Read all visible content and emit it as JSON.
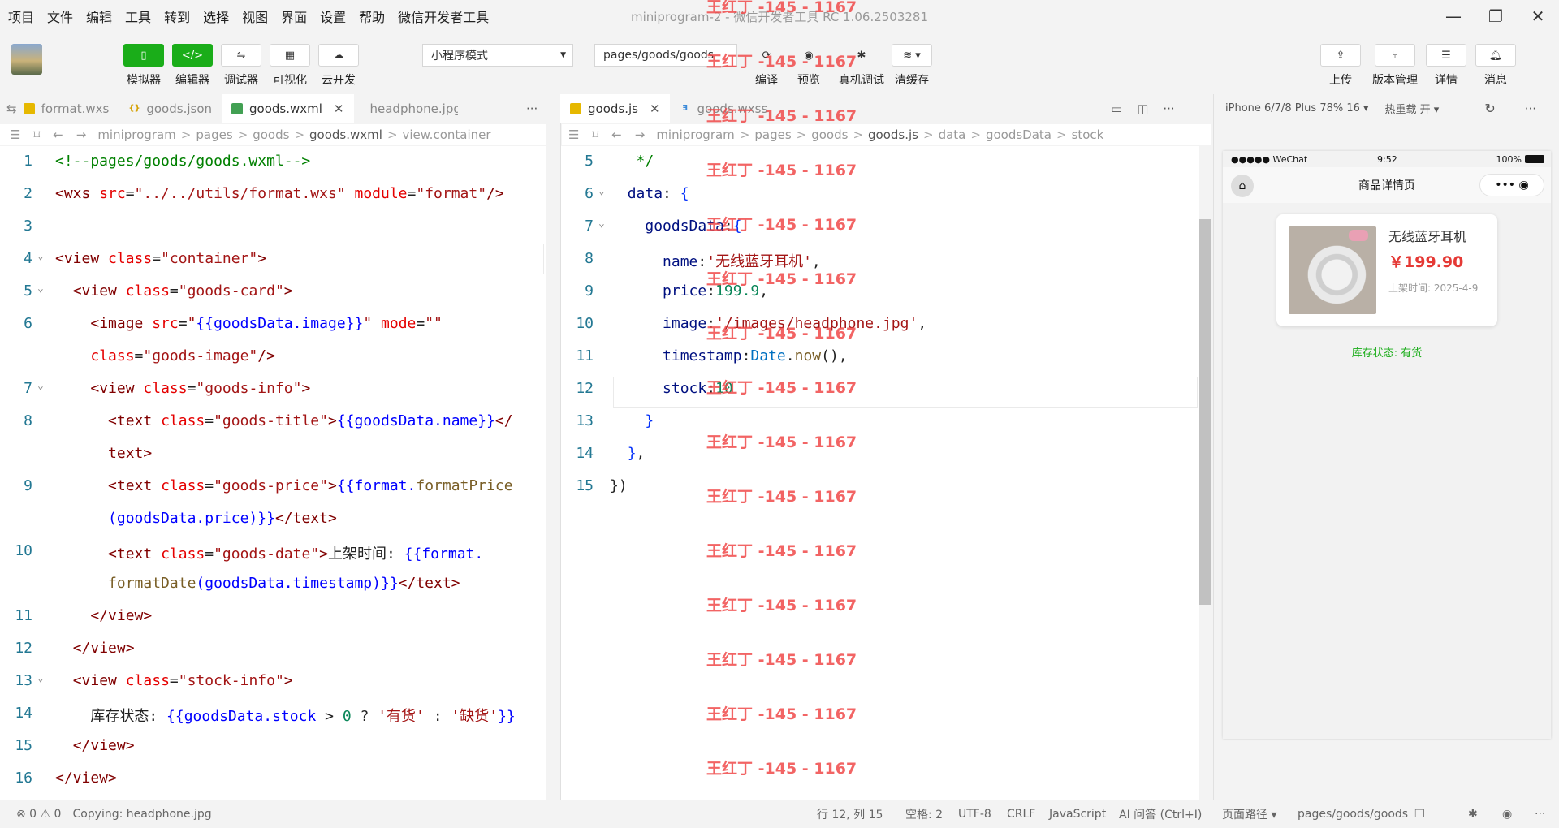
{
  "menu": [
    "项目",
    "文件",
    "编辑",
    "工具",
    "转到",
    "选择",
    "视图",
    "界面",
    "设置",
    "帮助",
    "微信开发者工具"
  ],
  "window_title": "miniprogram-2 - 微信开发者工具 RC 1.06.2503281",
  "window_controls": {
    "minimize": "—",
    "restore": "❐",
    "close": "✕"
  },
  "toolbar": {
    "simulator": "模拟器",
    "editor": "编辑器",
    "debugger": "调试器",
    "visual": "可视化",
    "cloud": "云开发",
    "mode_select": "小程序模式",
    "page_select": "pages/goods/goods",
    "compile": "编译",
    "preview": "预览",
    "remote_debug": "真机调试",
    "clear_cache": "清缓存",
    "upload": "上传",
    "version": "版本管理",
    "details": "详情",
    "messages": "消息"
  },
  "left_tabs": [
    "format.wxs",
    "goods.json",
    "goods.wxml",
    "headphone.jpg"
  ],
  "right_tabs": [
    "goods.js",
    "goods.wxss"
  ],
  "left_breadcrumb": [
    "miniprogram",
    "pages",
    "goods",
    "goods.wxml",
    "view.container"
  ],
  "right_breadcrumb": [
    "miniprogram",
    "pages",
    "goods",
    "goods.js",
    "data",
    "goodsData",
    "stock"
  ],
  "left_lines": [
    {
      "n": "1",
      "parts": [
        [
          "c-cm",
          "<!--pages/goods/goods.wxml-->"
        ]
      ]
    },
    {
      "n": "2",
      "parts": [
        [
          "c-tag",
          "<wxs "
        ],
        [
          "c-attr",
          "src"
        ],
        [
          "c-def",
          "="
        ],
        [
          "c-str",
          "\"../../utils/format.wxs\""
        ],
        [
          "c-def",
          " "
        ],
        [
          "c-attr",
          "module"
        ],
        [
          "c-def",
          "="
        ],
        [
          "c-str",
          "\"format\""
        ],
        [
          "c-tag",
          "/>"
        ]
      ]
    },
    {
      "n": "3",
      "parts": []
    },
    {
      "n": "4",
      "parts": [
        [
          "c-tag",
          "<view "
        ],
        [
          "c-attr",
          "class"
        ],
        [
          "c-def",
          "="
        ],
        [
          "c-str",
          "\"container\""
        ],
        [
          "c-tag",
          ">"
        ]
      ]
    },
    {
      "n": "5",
      "parts": [
        [
          "c-def",
          "  "
        ],
        [
          "c-tag",
          "<view "
        ],
        [
          "c-attr",
          "class"
        ],
        [
          "c-def",
          "="
        ],
        [
          "c-str",
          "\"goods-card\""
        ],
        [
          "c-tag",
          ">"
        ]
      ]
    },
    {
      "n": "6",
      "parts": [
        [
          "c-def",
          "    "
        ],
        [
          "c-tag",
          "<image "
        ],
        [
          "c-attr",
          "src"
        ],
        [
          "c-def",
          "="
        ],
        [
          "c-str",
          "\""
        ],
        [
          "c-bind",
          "{{goodsData.image}}"
        ],
        [
          "c-str",
          "\""
        ],
        [
          "c-def",
          " "
        ],
        [
          "c-attr",
          "mode"
        ],
        [
          "c-def",
          "="
        ],
        [
          "c-str",
          "\"\""
        ]
      ]
    },
    {
      "n": "",
      "parts": [
        [
          "c-def",
          "    "
        ],
        [
          "c-attr",
          "class"
        ],
        [
          "c-def",
          "="
        ],
        [
          "c-str",
          "\"goods-image\""
        ],
        [
          "c-tag",
          "/>"
        ]
      ]
    },
    {
      "n": "7",
      "parts": [
        [
          "c-def",
          "    "
        ],
        [
          "c-tag",
          "<view "
        ],
        [
          "c-attr",
          "class"
        ],
        [
          "c-def",
          "="
        ],
        [
          "c-str",
          "\"goods-info\""
        ],
        [
          "c-tag",
          ">"
        ]
      ]
    },
    {
      "n": "8",
      "parts": [
        [
          "c-def",
          "      "
        ],
        [
          "c-tag",
          "<text "
        ],
        [
          "c-attr",
          "class"
        ],
        [
          "c-def",
          "="
        ],
        [
          "c-str",
          "\"goods-title\""
        ],
        [
          "c-tag",
          ">"
        ],
        [
          "c-bind",
          "{{goodsData.name}}"
        ],
        [
          "c-tag",
          "</"
        ]
      ]
    },
    {
      "n": "",
      "parts": [
        [
          "c-def",
          "      "
        ],
        [
          "c-tag",
          "text>"
        ]
      ]
    },
    {
      "n": "9",
      "parts": [
        [
          "c-def",
          "      "
        ],
        [
          "c-tag",
          "<text "
        ],
        [
          "c-attr",
          "class"
        ],
        [
          "c-def",
          "="
        ],
        [
          "c-str",
          "\"goods-price\""
        ],
        [
          "c-tag",
          ">"
        ],
        [
          "c-bind",
          "{{format."
        ],
        [
          "c-fn",
          "formatPrice"
        ]
      ]
    },
    {
      "n": "",
      "parts": [
        [
          "c-def",
          "      "
        ],
        [
          "c-bind",
          "(goodsData.price)}}"
        ],
        [
          "c-tag",
          "</text>"
        ]
      ]
    },
    {
      "n": "10",
      "parts": [
        [
          "c-def",
          "      "
        ],
        [
          "c-tag",
          "<text "
        ],
        [
          "c-attr",
          "class"
        ],
        [
          "c-def",
          "="
        ],
        [
          "c-str",
          "\"goods-date\""
        ],
        [
          "c-tag",
          ">"
        ],
        [
          "c-txt",
          "上架时间: "
        ],
        [
          "c-bind",
          "{{format."
        ]
      ]
    },
    {
      "n": "",
      "parts": [
        [
          "c-def",
          "      "
        ],
        [
          "c-fn",
          "formatDate"
        ],
        [
          "c-bind",
          "(goodsData.timestamp)}}"
        ],
        [
          "c-tag",
          "</text>"
        ]
      ]
    },
    {
      "n": "11",
      "parts": [
        [
          "c-def",
          "    "
        ],
        [
          "c-tag",
          "</view>"
        ]
      ]
    },
    {
      "n": "12",
      "parts": [
        [
          "c-def",
          "  "
        ],
        [
          "c-tag",
          "</view>"
        ]
      ]
    },
    {
      "n": "13",
      "parts": [
        [
          "c-def",
          "  "
        ],
        [
          "c-tag",
          "<view "
        ],
        [
          "c-attr",
          "class"
        ],
        [
          "c-def",
          "="
        ],
        [
          "c-str",
          "\"stock-info\""
        ],
        [
          "c-tag",
          ">"
        ]
      ]
    },
    {
      "n": "14",
      "parts": [
        [
          "c-def",
          "    "
        ],
        [
          "c-txt",
          "库存状态: "
        ],
        [
          "c-bind",
          "{{goodsData.stock "
        ],
        [
          "c-def",
          "> "
        ],
        [
          "c-num",
          "0 "
        ],
        [
          "c-def",
          "? "
        ],
        [
          "c-str",
          "'有货' "
        ],
        [
          "c-def",
          ": "
        ],
        [
          "c-str",
          "'缺货'"
        ],
        [
          "c-bind",
          "}}"
        ]
      ]
    },
    {
      "n": "15",
      "parts": [
        [
          "c-def",
          "  "
        ],
        [
          "c-tag",
          "</view>"
        ]
      ]
    },
    {
      "n": "16",
      "parts": [
        [
          "c-tag",
          "</view>"
        ]
      ]
    }
  ],
  "right_lines": [
    {
      "n": "5",
      "parts": [
        [
          "c-def",
          "   "
        ],
        [
          "c-cm",
          "*/"
        ]
      ]
    },
    {
      "n": "6",
      "parts": [
        [
          "c-def",
          "  "
        ],
        [
          "c-key",
          "data"
        ],
        [
          "c-def",
          ": "
        ],
        [
          "c-brk",
          "{"
        ]
      ]
    },
    {
      "n": "7",
      "parts": [
        [
          "c-def",
          "    "
        ],
        [
          "c-key",
          "goodsData"
        ],
        [
          "c-def",
          ":"
        ],
        [
          "c-brk",
          "{"
        ]
      ]
    },
    {
      "n": "8",
      "parts": [
        [
          "c-def",
          "      "
        ],
        [
          "c-key",
          "name"
        ],
        [
          "c-def",
          ":"
        ],
        [
          "c-str",
          "'无线蓝牙耳机'"
        ],
        [
          "c-def",
          ","
        ]
      ]
    },
    {
      "n": "9",
      "parts": [
        [
          "c-def",
          "      "
        ],
        [
          "c-key",
          "price"
        ],
        [
          "c-def",
          ":"
        ],
        [
          "c-num",
          "199.9"
        ],
        [
          "c-def",
          ","
        ]
      ]
    },
    {
      "n": "10",
      "parts": [
        [
          "c-def",
          "      "
        ],
        [
          "c-key",
          "image"
        ],
        [
          "c-def",
          ":"
        ],
        [
          "c-str",
          "'/images/headphone.jpg'"
        ],
        [
          "c-def",
          ","
        ]
      ]
    },
    {
      "n": "11",
      "parts": [
        [
          "c-def",
          "      "
        ],
        [
          "c-key",
          "timestamp"
        ],
        [
          "c-def",
          ":"
        ],
        [
          "c-var",
          "Date"
        ],
        [
          "c-def",
          "."
        ],
        [
          "c-fn",
          "now"
        ],
        [
          "c-def",
          "(),"
        ]
      ]
    },
    {
      "n": "12",
      "parts": [
        [
          "c-def",
          "      "
        ],
        [
          "c-key",
          "stock"
        ],
        [
          "c-def",
          ":"
        ],
        [
          "c-num",
          "10"
        ]
      ]
    },
    {
      "n": "13",
      "parts": [
        [
          "c-def",
          "    "
        ],
        [
          "c-brk",
          "}"
        ]
      ]
    },
    {
      "n": "14",
      "parts": [
        [
          "c-def",
          "  "
        ],
        [
          "c-brk",
          "}"
        ],
        [
          "c-def",
          ","
        ]
      ]
    },
    {
      "n": "15",
      "parts": [
        [
          "c-def",
          ""
        ],
        [
          "c-def",
          "})"
        ]
      ]
    }
  ],
  "simulator": {
    "device": "iPhone 6/7/8 Plus 78% 16 ▾",
    "hot_reload": "热重载 开 ▾",
    "status_left": "●●●●● WeChat",
    "status_time": "9:52",
    "status_right": "100%",
    "nav_title": "商品详情页",
    "capsule": "•••  ◉",
    "goods_title": "无线蓝牙耳机",
    "goods_price": "￥199.90",
    "goods_date": "上架时间: 2025-4-9",
    "stock_status": "库存状态: 有货"
  },
  "watermark_text": "王红丁 -145 - 1167",
  "statusbar": {
    "errors": "⊗ 0  ⚠ 0",
    "copying": "Copying: headphone.jpg",
    "position": "行 12, 列 15",
    "spaces": "空格: 2",
    "encoding": "UTF-8",
    "eol": "CRLF",
    "language": "JavaScript",
    "ai": "AI 问答 (Ctrl+I)",
    "page_path_label": "页面路径 ▾",
    "page_path": "pages/goods/goods"
  }
}
